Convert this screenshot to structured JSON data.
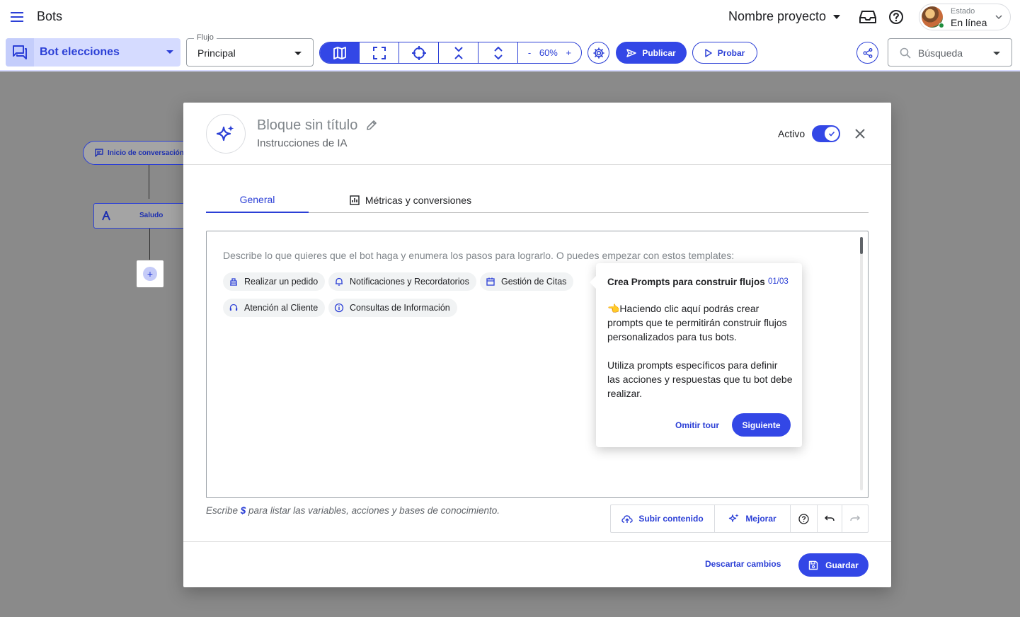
{
  "header": {
    "app_title": "Bots",
    "project_name": "Nombre proyecto",
    "status_label": "Estado",
    "status_value": "En línea"
  },
  "toolbar": {
    "bot_name": "Bot elecciones",
    "flow_label": "Flujo",
    "flow_value": "Principal",
    "zoom_minus": "-",
    "zoom_level": "60%",
    "zoom_plus": "+",
    "publish_label": "Publicar",
    "test_label": "Probar",
    "search_placeholder": "Búsqueda"
  },
  "canvas": {
    "start_node_label": "Inicio de conversación p",
    "greeting_node_label": "Saludo",
    "add_label": "+"
  },
  "modal": {
    "title": "Bloque sin título",
    "subtitle": "Instrucciones de IA",
    "active_label": "Activo",
    "tabs": [
      {
        "label": "General"
      },
      {
        "label": "Métricas y conversiones"
      }
    ],
    "editor_placeholder": "Describe lo que quieres que el bot haga y enumera los pasos para lograrlo. O puedes empezar con estos templates:",
    "templates": [
      {
        "label": "Realizar un pedido",
        "icon": "order-icon"
      },
      {
        "label": "Notificaciones y Recordatorios",
        "icon": "bell-icon"
      },
      {
        "label": "Gestión de Citas",
        "icon": "calendar-icon"
      },
      {
        "label": "Atención al Cliente",
        "icon": "headset-icon"
      },
      {
        "label": "Consultas de Información",
        "icon": "info-icon"
      }
    ],
    "hint_before": "Escribe ",
    "hint_symbol": "$",
    "hint_after": " para listar las variables, acciones y bases de conocimiento.",
    "upload_label": "Subir contenido",
    "improve_label": "Mejorar",
    "discard_label": "Descartar cambios",
    "save_label": "Guardar"
  },
  "tour": {
    "title": "Crea Prompts para construir flujos",
    "counter": "01/03",
    "paragraph1": "👈Haciendo clic aquí podrás crear prompts que te permitirán construir flujos personalizados para tus bots.",
    "paragraph2": "Utiliza prompts específicos para definir las acciones y respuestas que tu bot debe realizar.",
    "skip_label": "Omitir tour",
    "next_label": "Siguiente"
  },
  "colors": {
    "accent": "#3347e6",
    "accent_light": "#d5dbff",
    "overlay": "#8a8a8a",
    "online": "#1e8e3e"
  }
}
